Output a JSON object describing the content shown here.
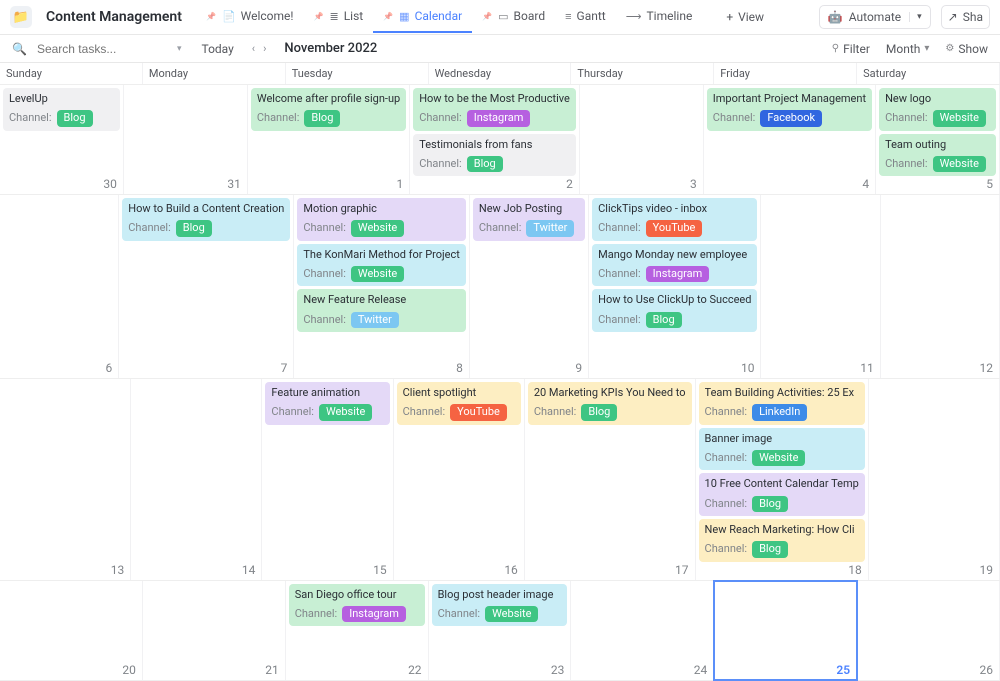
{
  "header": {
    "folder_icon": "📁",
    "title": "Content Management",
    "tabs": [
      {
        "icon": "📄",
        "label": "Welcome!",
        "pinned": true
      },
      {
        "icon": "≣",
        "label": "List",
        "pinned": true
      },
      {
        "icon": "▦",
        "label": "Calendar",
        "pinned": true,
        "active": true
      },
      {
        "icon": "▭",
        "label": "Board",
        "pinned": true
      },
      {
        "icon": "≡",
        "label": "Gantt"
      },
      {
        "icon": "⟶",
        "label": "Timeline"
      }
    ],
    "add_view": "View",
    "automate": {
      "icon": "🤖",
      "label": "Automate"
    },
    "share": {
      "icon": "↗",
      "label": "Sha"
    }
  },
  "toolbar": {
    "search_placeholder": "Search tasks...",
    "today": "Today",
    "month_label": "November 2022",
    "filter": "Filter",
    "month": "Month",
    "show": "Show"
  },
  "days": [
    "Sunday",
    "Monday",
    "Tuesday",
    "Wednesday",
    "Thursday",
    "Friday",
    "Saturday"
  ],
  "channel_label": "Channel:",
  "weeks": [
    {
      "cells": [
        {
          "date": 30,
          "cards": [
            {
              "title": "LevelUp",
              "bg": "grey",
              "channel": "Blog",
              "tg": "blog"
            }
          ]
        },
        {
          "date": 31,
          "cards": []
        },
        {
          "date": 1,
          "cards": [
            {
              "title": "Welcome after profile sign-up",
              "bg": "green",
              "channel": "Blog",
              "tg": "blog"
            }
          ]
        },
        {
          "date": 2,
          "cards": [
            {
              "title": "How to be the Most Productive",
              "bg": "green",
              "channel": "Instagram",
              "tg": "instagram"
            },
            {
              "title": "Testimonials from fans",
              "bg": "grey",
              "channel": "Blog",
              "tg": "blog"
            }
          ]
        },
        {
          "date": 3,
          "cards": []
        },
        {
          "date": 4,
          "cards": [
            {
              "title": "Important Project Management",
              "bg": "green",
              "channel": "Facebook",
              "tg": "facebook"
            }
          ]
        },
        {
          "date": 5,
          "cards": [
            {
              "title": "New logo",
              "bg": "green",
              "channel": "Website",
              "tg": "website"
            },
            {
              "title": "Team outing",
              "bg": "green",
              "channel": "Website",
              "tg": "website"
            }
          ]
        }
      ]
    },
    {
      "tall": true,
      "cells": [
        {
          "date": 6,
          "cards": []
        },
        {
          "date": 7,
          "cards": [
            {
              "title": "How to Build a Content Creation",
              "bg": "cyan",
              "channel": "Blog",
              "tg": "blog"
            }
          ]
        },
        {
          "date": 8,
          "cards": [
            {
              "title": "Motion graphic",
              "bg": "purple",
              "channel": "Website",
              "tg": "website"
            },
            {
              "title": "The KonMari Method for Project",
              "bg": "cyan",
              "channel": "Website",
              "tg": "website"
            },
            {
              "title": "New Feature Release",
              "bg": "green",
              "channel": "Twitter",
              "tg": "twitter"
            }
          ]
        },
        {
          "date": 9,
          "cards": [
            {
              "title": "New Job Posting",
              "bg": "purple",
              "channel": "Twitter",
              "tg": "twitter"
            }
          ]
        },
        {
          "date": 10,
          "cards": [
            {
              "title": "ClickTips video - inbox",
              "bg": "cyan",
              "channel": "YouTube",
              "tg": "youtube"
            },
            {
              "title": "Mango Monday new employee",
              "bg": "cyan",
              "channel": "Instagram",
              "tg": "instagram"
            },
            {
              "title": "How to Use ClickUp to Succeed",
              "bg": "cyan",
              "channel": "Blog",
              "tg": "blog"
            }
          ]
        },
        {
          "date": 11,
          "cards": []
        },
        {
          "date": 12,
          "cards": []
        }
      ]
    },
    {
      "tall": true,
      "cells": [
        {
          "date": 13,
          "cards": []
        },
        {
          "date": 14,
          "cards": []
        },
        {
          "date": 15,
          "cards": [
            {
              "title": "Feature animation",
              "bg": "purple",
              "channel": "Website",
              "tg": "website"
            }
          ]
        },
        {
          "date": 16,
          "cards": [
            {
              "title": "Client spotlight",
              "bg": "yellow",
              "channel": "YouTube",
              "tg": "youtube"
            }
          ]
        },
        {
          "date": 17,
          "cards": [
            {
              "title": "20 Marketing KPIs You Need to",
              "bg": "yellow",
              "channel": "Blog",
              "tg": "blog"
            }
          ]
        },
        {
          "date": 18,
          "cards": [
            {
              "title": "Team Building Activities: 25 Ex",
              "bg": "yellow",
              "channel": "LinkedIn",
              "tg": "linkedin"
            },
            {
              "title": "Banner image",
              "bg": "cyan",
              "channel": "Website",
              "tg": "website"
            },
            {
              "title": "10 Free Content Calendar Temp",
              "bg": "purple",
              "channel": "Blog",
              "tg": "blog"
            },
            {
              "title": "New Reach Marketing: How Cli",
              "bg": "yellow",
              "channel": "Blog",
              "tg": "blog"
            }
          ]
        },
        {
          "date": 19,
          "cards": []
        }
      ]
    },
    {
      "cells": [
        {
          "date": 20,
          "cards": []
        },
        {
          "date": 21,
          "cards": []
        },
        {
          "date": 22,
          "cards": [
            {
              "title": "San Diego office tour",
              "bg": "green",
              "channel": "Instagram",
              "tg": "instagram"
            }
          ]
        },
        {
          "date": 23,
          "cards": [
            {
              "title": "Blog post header image",
              "bg": "cyan",
              "channel": "Website",
              "tg": "website"
            }
          ]
        },
        {
          "date": 24,
          "cards": []
        },
        {
          "date": 25,
          "today": true,
          "cards": []
        },
        {
          "date": 26,
          "cards": []
        }
      ]
    }
  ]
}
